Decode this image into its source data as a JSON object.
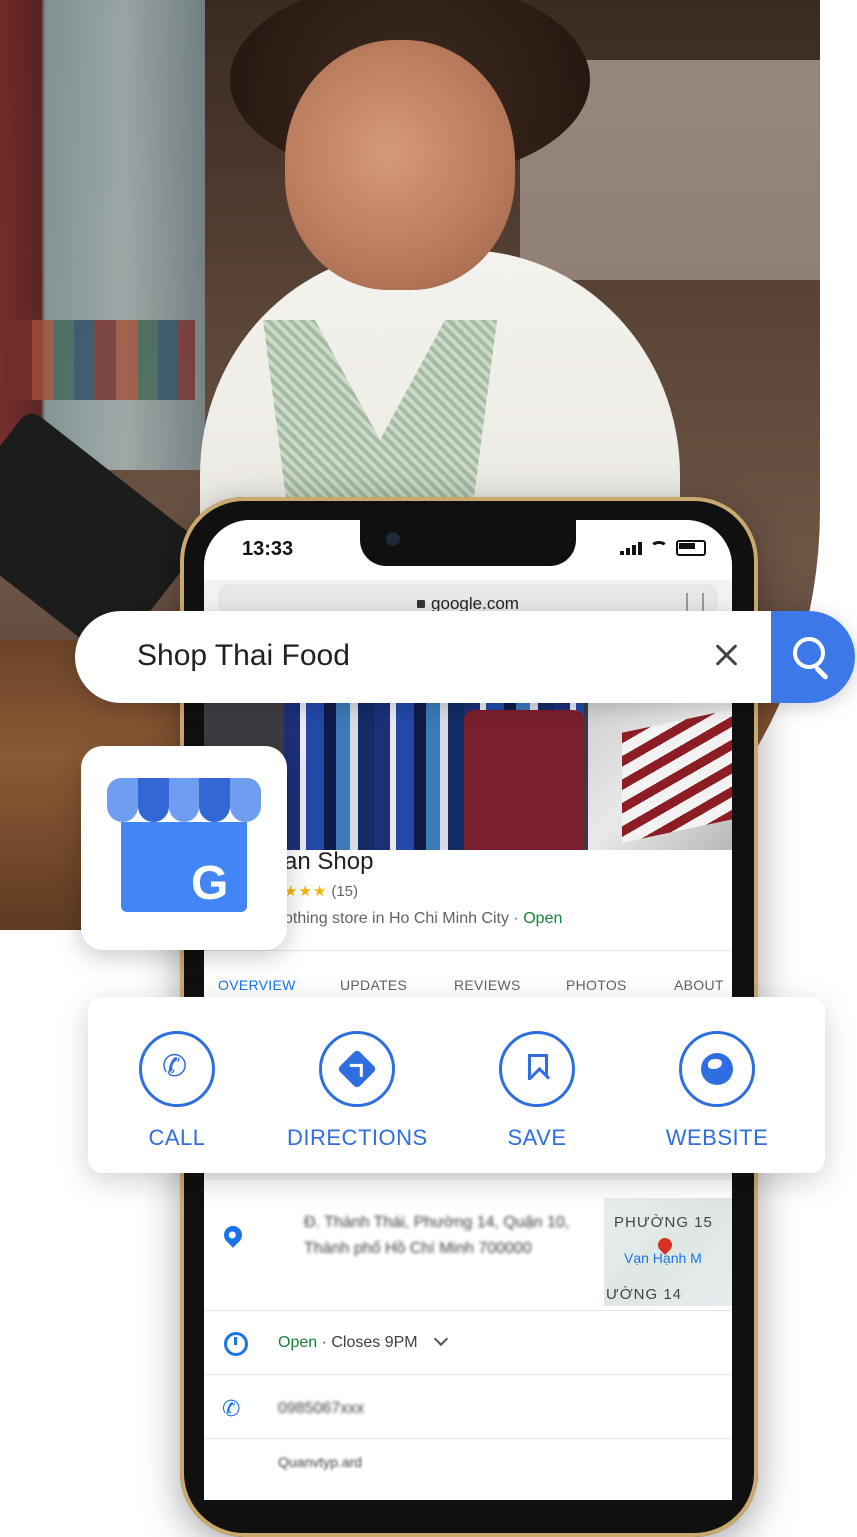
{
  "phone": {
    "time": "13:33",
    "url": "google.com"
  },
  "search": {
    "query": "Shop Thai Food"
  },
  "place": {
    "name": "an Shop",
    "rating_stars": "★★★",
    "review_count": "(15)",
    "category": "othing store in Ho Chi Minh City",
    "separator": "·",
    "status": "Open"
  },
  "tabs": [
    "OVERVIEW",
    "UPDATES",
    "REVIEWS",
    "PHOTOS",
    "ABOUT"
  ],
  "actions": [
    {
      "label": "CALL",
      "icon": "phone-icon"
    },
    {
      "label": "DIRECTIONS",
      "icon": "directions-icon"
    },
    {
      "label": "SAVE",
      "icon": "bookmark-icon"
    },
    {
      "label": "WEBSITE",
      "icon": "globe-icon"
    }
  ],
  "details": {
    "address": "Đ. Thành Thái, Phường 14, Quận 10, Thành phố Hồ Chí Minh 700000",
    "map_label_1": "PHƯỜNG 15",
    "map_label_2": "Vạn Hạnh M",
    "map_label_3": "ƯỜNG 14",
    "hours_status": "Open",
    "hours_text": "· Closes 9PM",
    "phone_number": "0985067xxx",
    "website_text": "Quanvtyp.ard"
  },
  "colors": {
    "accent": "#2f6ee0",
    "search_button": "#3c78e8",
    "open_green": "#188038",
    "star": "#f5b400"
  }
}
